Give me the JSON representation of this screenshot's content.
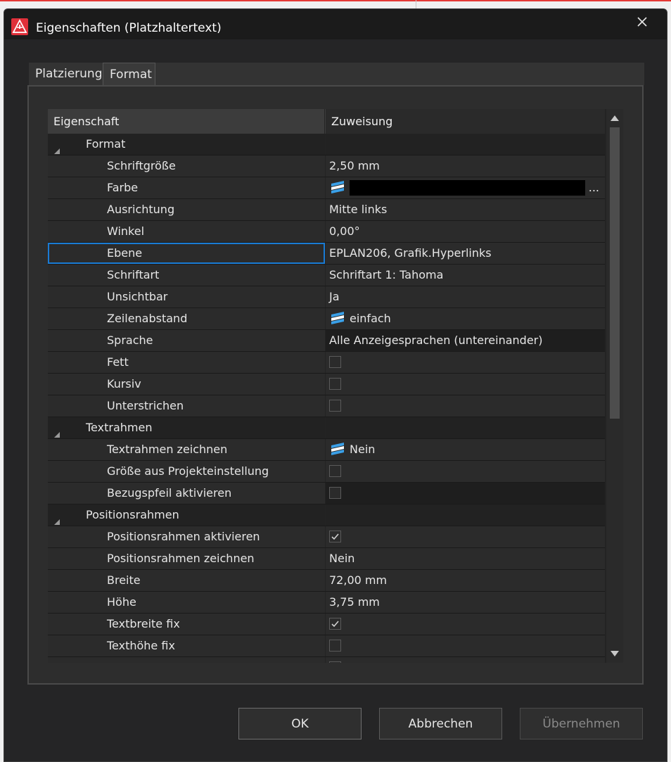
{
  "dialog": {
    "title": "Eigenschaften (Platzhaltertext)"
  },
  "tabs": [
    {
      "label": "Platzierung",
      "active": false
    },
    {
      "label": "Format",
      "active": true
    }
  ],
  "grid": {
    "columns": [
      "Eigenschaft",
      "Zuweisung"
    ],
    "rows": [
      {
        "type": "group",
        "name": "Format"
      },
      {
        "type": "value",
        "name": "Schriftgröße",
        "value": "2,50 mm"
      },
      {
        "type": "color",
        "name": "Farbe",
        "value": "",
        "color": "#000000",
        "ellipsis": "..."
      },
      {
        "type": "value",
        "name": "Ausrichtung",
        "value": "Mitte links"
      },
      {
        "type": "value",
        "name": "Winkel",
        "value": "0,00°"
      },
      {
        "type": "value",
        "name": "Ebene",
        "value": "EPLAN206, Grafik.Hyperlinks",
        "selected": true
      },
      {
        "type": "value",
        "name": "Schriftart",
        "value": "Schriftart 1: Tahoma"
      },
      {
        "type": "value",
        "name": "Unsichtbar",
        "value": "Ja"
      },
      {
        "type": "stacked",
        "name": "Zeilenabstand",
        "value": "einfach"
      },
      {
        "type": "value",
        "name": "Sprache",
        "value": "Alle Anzeigesprachen (untereinander)",
        "dark": true
      },
      {
        "type": "check",
        "name": "Fett",
        "checked": false
      },
      {
        "type": "check",
        "name": "Kursiv",
        "checked": false
      },
      {
        "type": "check",
        "name": "Unterstrichen",
        "checked": false
      },
      {
        "type": "group",
        "name": "Textrahmen"
      },
      {
        "type": "stacked",
        "name": "Textrahmen zeichnen",
        "value": "Nein"
      },
      {
        "type": "check",
        "name": "Größe aus Projekteinstellung",
        "checked": false
      },
      {
        "type": "check",
        "name": "Bezugspfeil aktivieren",
        "checked": false,
        "dark": true
      },
      {
        "type": "group",
        "name": "Positionsrahmen"
      },
      {
        "type": "check",
        "name": "Positionsrahmen aktivieren",
        "checked": true
      },
      {
        "type": "value",
        "name": "Positionsrahmen zeichnen",
        "value": "Nein"
      },
      {
        "type": "value",
        "name": "Breite",
        "value": "72,00 mm"
      },
      {
        "type": "value",
        "name": "Höhe",
        "value": "3,75 mm"
      },
      {
        "type": "check",
        "name": "Textbreite fix",
        "checked": true
      },
      {
        "type": "check",
        "name": "Texthöhe fix",
        "checked": false
      },
      {
        "type": "check",
        "name": "",
        "checked": false
      }
    ]
  },
  "buttons": {
    "ok": "OK",
    "cancel": "Abbrechen",
    "apply": "Übernehmen"
  },
  "icons": {
    "app": "eplan-warning-icon",
    "close": "close-icon",
    "stacked": "stacked-layers-icon"
  },
  "colors": {
    "accent": "#1a7bd4",
    "app_icon": "#e0303a"
  }
}
